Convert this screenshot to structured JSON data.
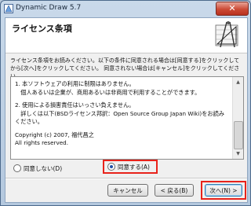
{
  "window": {
    "title": "Dynamic Draw 5.7",
    "close_label": "✕"
  },
  "header": {
    "title": "ライセンス条項"
  },
  "intro": "ライセンス条項をお読みください。以下の条件に同意される場合は[同意する]をクリックしてから[次へ]をクリックしてください。 同意されない場合は[キャンセル]をクリックしてください。",
  "license": {
    "paragraphs": [
      "1. 本ソフトウェアの利用に制限はありません。\n　個人あるいは企業が、商用あるいは非商用で利用することができます。",
      "2. 使用による損害責任はいっさい負えません。\n　詳しくは以下(BSDライセンス邦訳：Open Source Group Japan Wiki)をお読みください。",
      "Copyright (c) 2007, 福代昌之\nAll rights reserved."
    ]
  },
  "options": {
    "disagree": "同意しない(D)",
    "agree": "同意する(A)",
    "selected": "agree"
  },
  "buttons": {
    "cancel": "キャンセル",
    "back": "< 戻る(B)",
    "next": "次へ(N) >"
  },
  "accent": {
    "highlight": "#e8231b",
    "focus": "#3c7fb1"
  }
}
